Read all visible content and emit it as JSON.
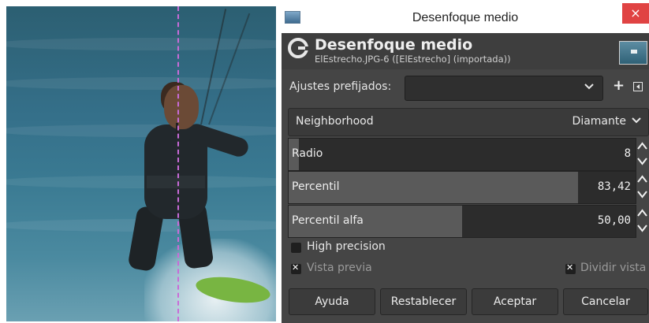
{
  "window": {
    "title": "Desenfoque medio",
    "close_glyph": "×"
  },
  "header": {
    "title": "Desenfoque medio",
    "subtitle": "ElEstrecho.JPG-6 ([ElEstrecho] (importada))",
    "icon": "gimp-logo-icon"
  },
  "presets": {
    "label": "Ajustes prefijados:",
    "value": "",
    "add_glyph": "+"
  },
  "neighborhood": {
    "label": "Neighborhood",
    "value": "Diamante"
  },
  "params": [
    {
      "label": "Radio",
      "value": "8",
      "fraction": 0.03
    },
    {
      "label": "Percentil",
      "value": "83,42",
      "fraction": 0.8342
    },
    {
      "label": "Percentil alfa",
      "value": "50,00",
      "fraction": 0.5
    }
  ],
  "options": {
    "high_precision": {
      "label": "High precision",
      "checked": false
    },
    "preview": {
      "label": "Vista previa",
      "checked": true
    },
    "split_view": {
      "label": "Dividir vista",
      "checked": true
    }
  },
  "buttons": {
    "help": "Ayuda",
    "reset": "Restablecer",
    "ok": "Aceptar",
    "cancel": "Cancelar"
  },
  "colors": {
    "dialog_bg": "#454545",
    "close_red": "#e04343",
    "split_guide": "#c86bd8"
  }
}
